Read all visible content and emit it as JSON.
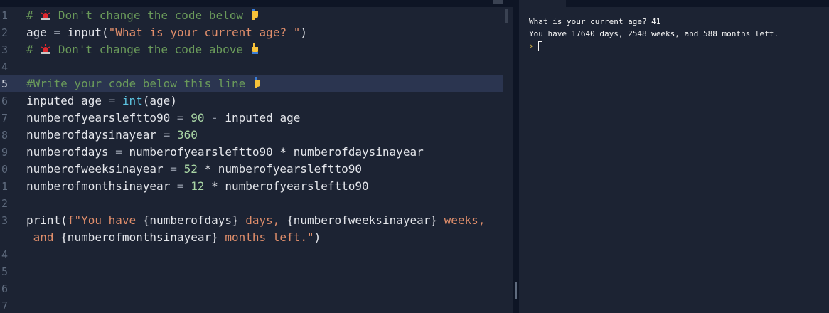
{
  "editor": {
    "line_numbers": [
      "1",
      "2",
      "3",
      "4",
      "5",
      "6",
      "7",
      "8",
      "9",
      "0",
      "1",
      "2",
      "3",
      "",
      "4",
      "5",
      "6",
      "7"
    ],
    "active_line": 5,
    "lines": {
      "l1_comment": "# ",
      "l1_rest": " Don't change the code below ",
      "l2_var": "age",
      "l2_eq": " = ",
      "l2_func": "input",
      "l2_open": "(",
      "l2_str": "\"What is your current age? \"",
      "l2_close": ")",
      "l3_comment": "# ",
      "l3_rest": " Don't change the code above ",
      "l5_comment": "#Write your code below this line ",
      "l6_var": "inputed_age",
      "l6_eq": " = ",
      "l6_func": "int",
      "l6_args": "(age)",
      "l7_var": "numberofyearsleftto90",
      "l7_eq": " = ",
      "l7_num": "90",
      "l7_op": " - ",
      "l7_rest": "inputed_age",
      "l8_var": "numberofdaysinayear",
      "l8_eq": " = ",
      "l8_num": "360",
      "l9_var": "numberofdays",
      "l9_eq": " = ",
      "l9_rest": "numberofyearsleftto90 * numberofdaysinayear",
      "l10_var": "numberofweeksinayear",
      "l10_eq": " = ",
      "l10_num": "52",
      "l10_rest": " * numberofyearsleftto90",
      "l11_var": "numberofmonthsinayear",
      "l11_eq": " = ",
      "l11_num": "12",
      "l11_rest": " * numberofyearsleftto90",
      "l13_func": "print",
      "l13_open": "(",
      "l13_f": "f",
      "l13_s1": "\"You have ",
      "l13_v1": "{numberofdays}",
      "l13_s2": " days, ",
      "l13_v2": "{numberofweeksinayear}",
      "l13_s3": " weeks,",
      "l13b_s1": " and ",
      "l13b_v1": "{numberofmonthsinayear}",
      "l13b_s2": " months left.\"",
      "l13b_close": ")"
    },
    "icons": {
      "siren": "police-siren-emoji",
      "pointer_down": "pointing-down-emoji",
      "pointer_up": "pointing-up-emoji"
    }
  },
  "console": {
    "output_lines": [
      "What is your current age? 41",
      "You have 17640 days, 2548 weeks, and 588 months left."
    ],
    "prompt_symbol": "›"
  },
  "colors": {
    "editor_bg": "#1c2333",
    "topbar_bg": "#0e1525",
    "comment": "#6a9a5a",
    "string": "#e08e6b",
    "number": "#a9d6a5",
    "builtin": "#5cc3e0",
    "prompt": "#f2c94c"
  }
}
